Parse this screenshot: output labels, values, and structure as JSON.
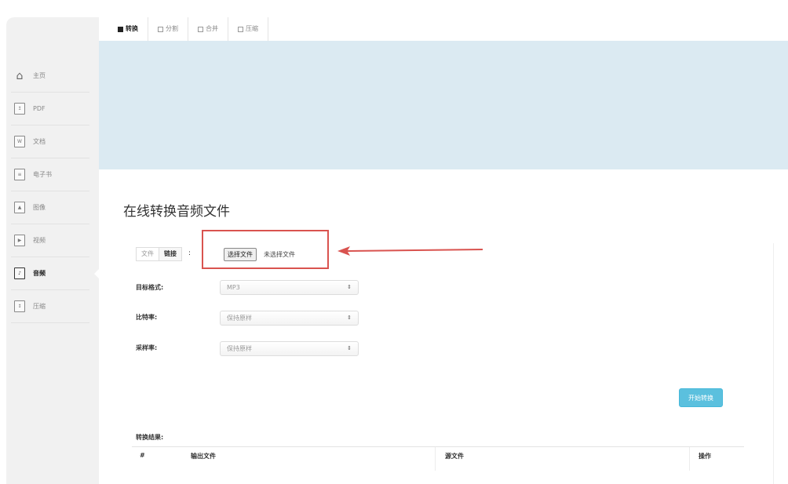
{
  "tabs": [
    {
      "label": "转换",
      "active": true
    },
    {
      "label": "分割",
      "active": false
    },
    {
      "label": "合并",
      "active": false
    },
    {
      "label": "压缩",
      "active": false
    }
  ],
  "sidebar": {
    "items": [
      {
        "label": "主页",
        "icon": "home-icon"
      },
      {
        "label": "PDF",
        "icon": "pdf-file-icon"
      },
      {
        "label": "文档",
        "icon": "word-file-icon"
      },
      {
        "label": "电子书",
        "icon": "ebook-file-icon"
      },
      {
        "label": "图像",
        "icon": "image-file-icon"
      },
      {
        "label": "视频",
        "icon": "video-file-icon"
      },
      {
        "label": "音频",
        "icon": "audio-file-icon",
        "active": true
      },
      {
        "label": "压缩",
        "icon": "archive-file-icon"
      }
    ]
  },
  "main": {
    "title": "在线转换音频文件",
    "source_toggle": {
      "file": "文件",
      "link": "链接",
      "colon": ":"
    },
    "file_button": "选择文件",
    "file_status": "未选择文件",
    "fields": [
      {
        "label": "目标格式:",
        "value": "MP3"
      },
      {
        "label": "比特率:",
        "value": "保持原样"
      },
      {
        "label": "采样率:",
        "value": "保持原样"
      }
    ],
    "start_button": "开始转换",
    "result": {
      "label": "转换结果:",
      "headers": [
        "#",
        "输出文件",
        "源文件",
        "操作"
      ]
    }
  },
  "colors": {
    "banner": "#dbeaf2",
    "highlight_border": "#d9534f",
    "arrow": "#d9534f",
    "start_button": "#5bc0de"
  }
}
